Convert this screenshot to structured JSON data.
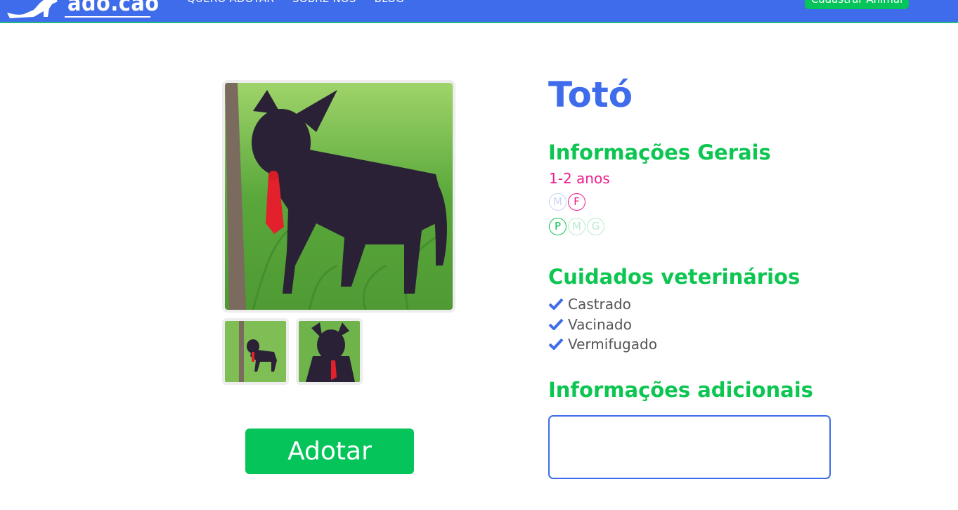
{
  "header": {
    "logo_text": "ado.cão",
    "nav": [
      {
        "label": "QUERO ADOTAR"
      },
      {
        "label": "SOBRE NÓS"
      },
      {
        "label": "BLOG"
      }
    ],
    "cta_label": "Cadastrar Animal"
  },
  "pet": {
    "name": "Totó",
    "general_title": "Informações Gerais",
    "age": "1-2 anos",
    "sex_options": [
      "M",
      "F"
    ],
    "sex_selected": "F",
    "size_options": [
      "P",
      "M",
      "G"
    ],
    "size_selected": "P",
    "vet_title": "Cuidados veterinários",
    "vet_items": [
      "Castrado",
      "Vacinado",
      "Vermifugado"
    ],
    "extra_title": "Informações adicionais",
    "extra_value": ""
  },
  "actions": {
    "adopt_label": "Adotar"
  },
  "colors": {
    "brand_blue": "#3f6cea",
    "brand_green": "#05c45a",
    "title_green": "#0dc652",
    "female_pink": "#ee1d8c"
  },
  "icons": [
    "dog-logo-icon",
    "check-icon"
  ]
}
